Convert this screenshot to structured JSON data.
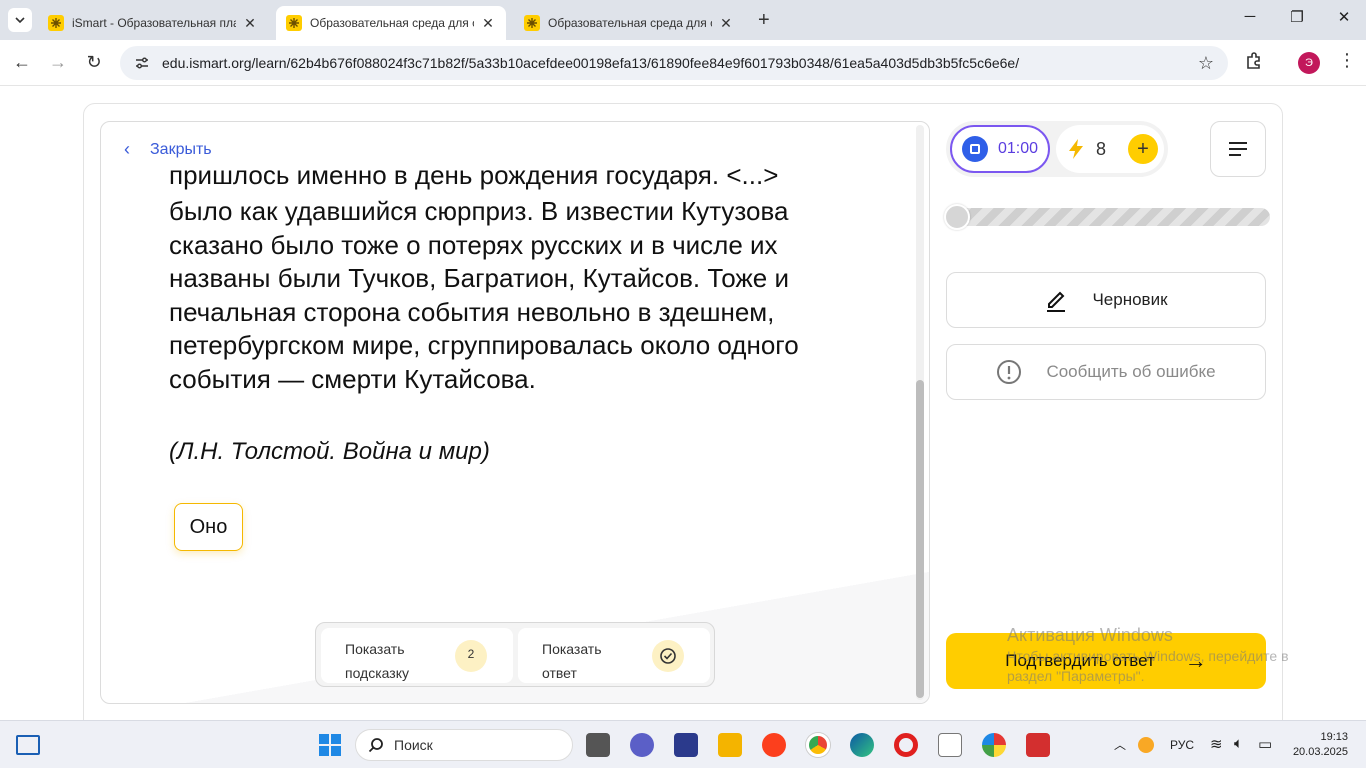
{
  "browser": {
    "tabs": [
      {
        "title": "iSmart - Образовательная пла",
        "active": false
      },
      {
        "title": "Образовательная среда для са",
        "active": true
      },
      {
        "title": "Образовательная среда для са",
        "active": false
      }
    ],
    "url": "edu.ismart.org/learn/62b4b676f088024f3c71b82f/5a33b10acefdee00198efa13/61890fee84e9f601793b0348/61ea5a403d5db3b5fc5c6e6e/",
    "profile_initial": "Э"
  },
  "task": {
    "close_label": "Закрыть",
    "passage_cut_line": "пришлось именно в день рождения государя. <...>",
    "passage_lines": [
      "было как удавшийся сюрприз. В известии Кутузова",
      "сказано было тоже о потерях русских и в числе их",
      "названы были Тучков, Багратион, Кутайсов. Тоже и",
      "печальная сторона события невольно в здешнем,",
      "петербургском мире, сгруппировалась около одного",
      "события — смерти Кутайсова."
    ],
    "citation": "(Л.Н. Толстой. Война и мир)",
    "answer_chip": "Оно",
    "hint_label_1": "Показать",
    "hint_label_2": "подсказку",
    "hint_count": "2",
    "answer_label_1": "Показать",
    "answer_label_2": "ответ"
  },
  "panel": {
    "timer": "01:00",
    "energy": "8",
    "progress_fraction": 0,
    "draft_label": "Черновик",
    "report_label": "Сообщить об ошибке",
    "submit_label": "Подтвердить ответ"
  },
  "watermark": {
    "title": "Активация Windows",
    "line1": "Чтобы активировать Windows, перейдите в",
    "line2": "раздел \"Параметры\"."
  },
  "taskbar": {
    "search_placeholder": "Поиск",
    "lang": "РУС",
    "time": "19:13",
    "date": "20.03.2025"
  },
  "colors": {
    "accent_yellow": "#ffcd00",
    "timer_purple": "#7b57f0",
    "link_blue": "#3a5bd9"
  }
}
